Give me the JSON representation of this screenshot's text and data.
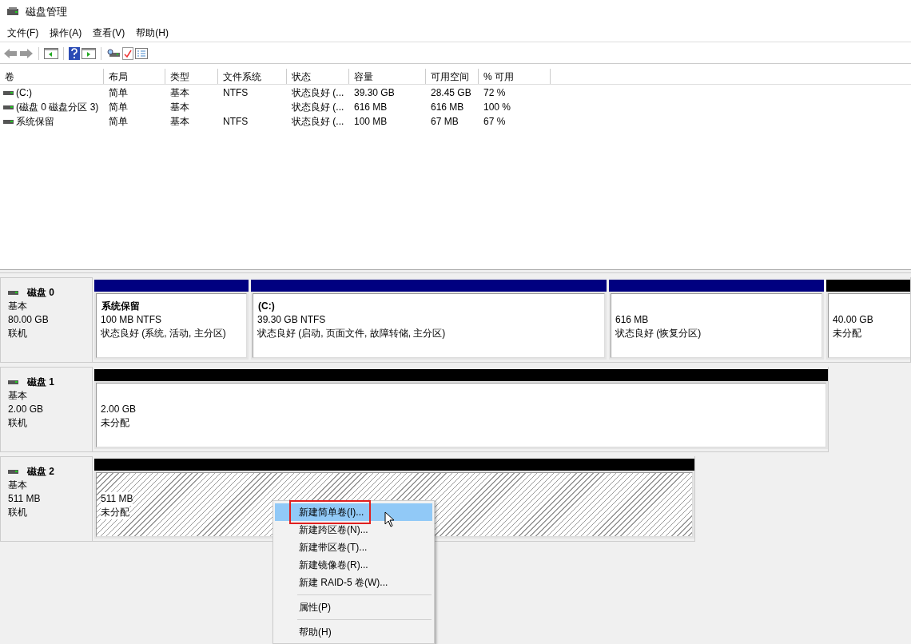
{
  "window": {
    "title": "磁盘管理"
  },
  "menu": [
    "文件(F)",
    "操作(A)",
    "查看(V)",
    "帮助(H)"
  ],
  "volume_table": {
    "columns": [
      "卷",
      "布局",
      "类型",
      "文件系统",
      "状态",
      "容量",
      "可用空间",
      "% 可用"
    ],
    "rows": [
      [
        "(C:)",
        "简单",
        "基本",
        "NTFS",
        "状态良好 (...",
        "39.30 GB",
        "28.45 GB",
        "72 %"
      ],
      [
        "(磁盘 0 磁盘分区 3)",
        "简单",
        "基本",
        "",
        "状态良好 (...",
        "616 MB",
        "616 MB",
        "100 %"
      ],
      [
        "系统保留",
        "简单",
        "基本",
        "NTFS",
        "状态良好 (...",
        "100 MB",
        "67 MB",
        "67 %"
      ]
    ]
  },
  "disks": [
    {
      "name": "磁盘 0",
      "type": "基本",
      "size": "80.00 GB",
      "state": "联机",
      "partitions": [
        {
          "kind": "primary",
          "selected": false,
          "title": "系统保留",
          "size": "100 MB NTFS",
          "status": "状态良好 (系统, 活动, 主分区)"
        },
        {
          "kind": "primary",
          "selected": false,
          "title": "(C:)",
          "size": "39.30 GB NTFS",
          "status": "状态良好 (启动, 页面文件, 故障转储, 主分区)"
        },
        {
          "kind": "primary",
          "selected": false,
          "size": "616 MB",
          "status": "状态良好 (恢复分区)"
        },
        {
          "kind": "unallocated",
          "selected": false,
          "size": "40.00 GB",
          "status": "未分配"
        }
      ]
    },
    {
      "name": "磁盘 1",
      "type": "基本",
      "size": "2.00 GB",
      "state": "联机",
      "partitions": [
        {
          "kind": "unallocated",
          "selected": false,
          "size": "2.00 GB",
          "status": "未分配"
        }
      ]
    },
    {
      "name": "磁盘 2",
      "type": "基本",
      "size": "511 MB",
      "state": "联机",
      "partitions": [
        {
          "kind": "unallocated",
          "selected": true,
          "size": "511 MB",
          "status": "未分配"
        }
      ]
    }
  ],
  "context_menu": [
    {
      "kind": "item",
      "label": "新建简单卷(I)...",
      "selected": true,
      "outlined": true
    },
    {
      "kind": "item",
      "label": "新建跨区卷(N)...",
      "selected": false,
      "outlined": false
    },
    {
      "kind": "item",
      "label": "新建带区卷(T)...",
      "selected": false,
      "outlined": false
    },
    {
      "kind": "item",
      "label": "新建镜像卷(R)...",
      "selected": false,
      "outlined": false
    },
    {
      "kind": "item",
      "label": "新建 RAID-5 卷(W)...",
      "selected": false,
      "outlined": false
    },
    {
      "kind": "separator"
    },
    {
      "kind": "item",
      "label": "属性(P)",
      "selected": false,
      "outlined": false
    },
    {
      "kind": "separator"
    },
    {
      "kind": "item",
      "label": "帮助(H)",
      "selected": false,
      "outlined": false
    }
  ]
}
